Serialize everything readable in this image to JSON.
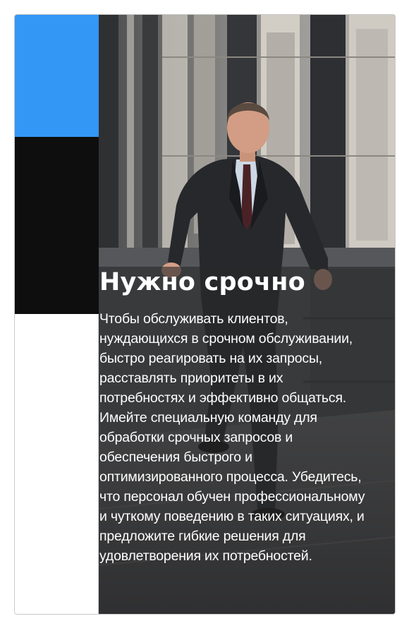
{
  "card": {
    "title": "Нужно срочно",
    "body": "Чтобы обслуживать клиентов, нуждающихся в срочном обслуживании, быстро реагировать на их запросы, расставлять приоритеты в их потребностях и эффективно общаться. Имейте специальную команду для обработки срочных запросов и обеспечения быстрого и оптимизированного процесса. Убедитесь, что персонал обучен профессиональному и чуткому поведению в таких ситуациях, и предложите гибкие решения для удовлетворения их потребностей."
  },
  "colors": {
    "accent_blue": "#3397f5",
    "block_black": "#0e0e0e"
  },
  "image": {
    "subject": "businessman-running-photo"
  }
}
